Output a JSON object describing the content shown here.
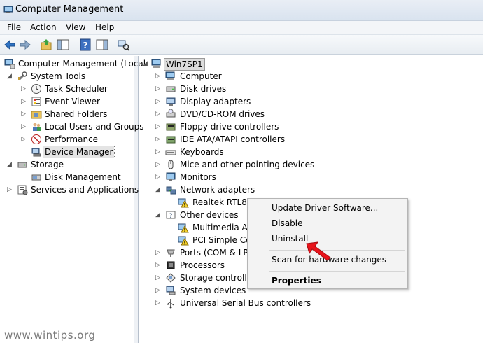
{
  "window": {
    "title": "Computer Management"
  },
  "menu": [
    "File",
    "Action",
    "View",
    "Help"
  ],
  "left_tree": {
    "root": "Computer Management (Local",
    "system_tools": "System Tools",
    "system_tools_items": [
      "Task Scheduler",
      "Event Viewer",
      "Shared Folders",
      "Local Users and Groups",
      "Performance",
      "Device Manager"
    ],
    "storage": "Storage",
    "disk_management": "Disk Management",
    "services": "Services and Applications"
  },
  "device_tree": {
    "root": "Win7SP1",
    "categories": [
      "Computer",
      "Disk drives",
      "Display adapters",
      "DVD/CD-ROM drives",
      "Floppy drive controllers",
      "IDE ATA/ATAPI controllers",
      "Keyboards",
      "Mice and other pointing devices",
      "Monitors",
      "Network adapters"
    ],
    "network_child": "Realtek RTL813",
    "other_devices": "Other devices",
    "other_children": [
      "Multimedia Au",
      "PCI Simple Cor"
    ],
    "more_categories": [
      "Ports (COM & LPT",
      "Processors",
      "Storage controllers",
      "System devices",
      "Universal Serial Bus controllers"
    ]
  },
  "context_menu": {
    "items": [
      "Update Driver Software...",
      "Disable",
      "Uninstall",
      "Scan for hardware changes",
      "Properties"
    ]
  },
  "watermark": "www.wintips.org",
  "colors": {
    "arrow": "#e8141b",
    "selection": "#e4e4e4"
  }
}
